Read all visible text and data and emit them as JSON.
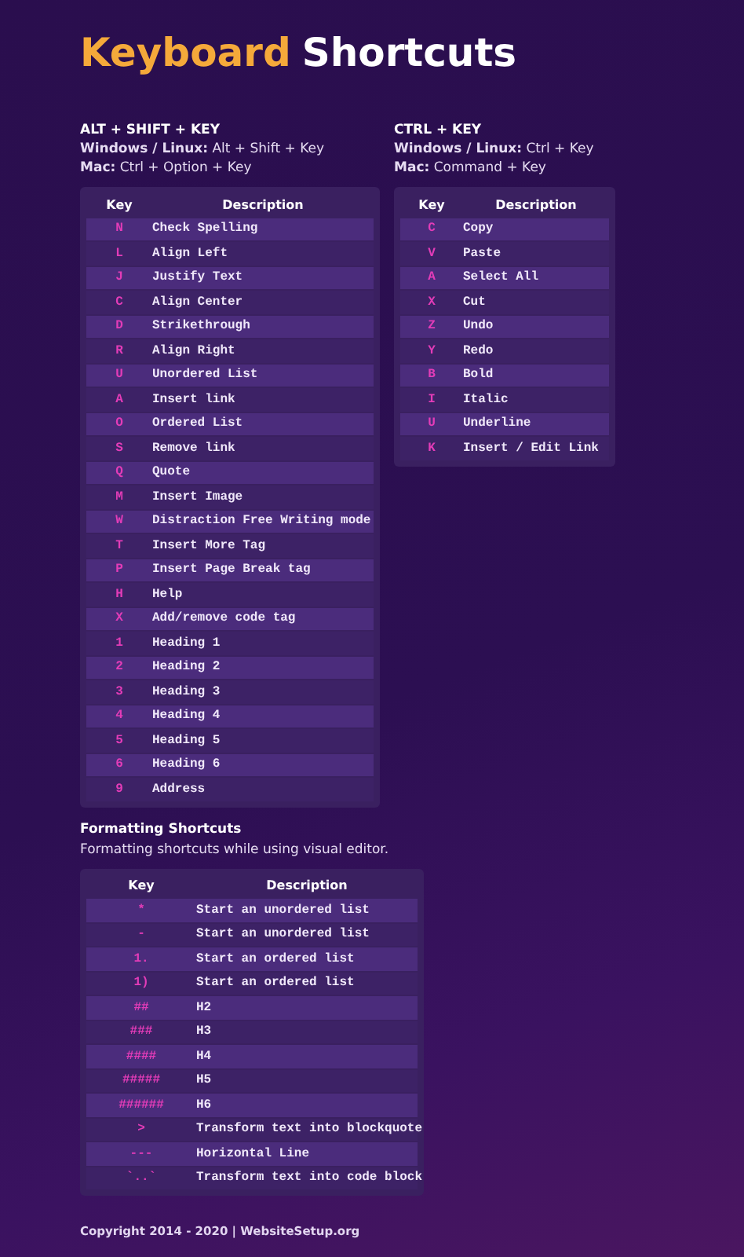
{
  "title": {
    "highlight": "Keyboard",
    "rest": "Shortcuts"
  },
  "sections": [
    {
      "heading": "ALT + SHIFT + KEY",
      "lines": [
        "**Windows / Linux:** Alt + Shift + Key",
        "**Mac:** Ctrl + Option + Key"
      ],
      "columns": [
        "Key",
        "Description"
      ],
      "rows": [
        {
          "key": "N",
          "description": "Check Spelling"
        },
        {
          "key": "L",
          "description": "Align Left"
        },
        {
          "key": "J",
          "description": "Justify Text"
        },
        {
          "key": "C",
          "description": "Align Center"
        },
        {
          "key": "D",
          "description": "Strikethrough"
        },
        {
          "key": "R",
          "description": "Align Right"
        },
        {
          "key": "U",
          "description": "Unordered List"
        },
        {
          "key": "A",
          "description": "Insert link"
        },
        {
          "key": "O",
          "description": "Ordered List"
        },
        {
          "key": "S",
          "description": "Remove link"
        },
        {
          "key": "Q",
          "description": "Quote"
        },
        {
          "key": "M",
          "description": "Insert Image"
        },
        {
          "key": "W",
          "description": "Distraction Free Writing mode"
        },
        {
          "key": "T",
          "description": "Insert More Tag"
        },
        {
          "key": "P",
          "description": "Insert Page Break tag"
        },
        {
          "key": "H",
          "description": "Help"
        },
        {
          "key": "X",
          "description": "Add/remove code tag"
        },
        {
          "key": "1",
          "description": "Heading 1"
        },
        {
          "key": "2",
          "description": "Heading 2"
        },
        {
          "key": "3",
          "description": "Heading 3"
        },
        {
          "key": "4",
          "description": "Heading 4"
        },
        {
          "key": "5",
          "description": "Heading 5"
        },
        {
          "key": "6",
          "description": "Heading 6"
        },
        {
          "key": "9",
          "description": "Address"
        }
      ]
    },
    {
      "heading": "CTRL + KEY",
      "lines": [
        "**Windows / Linux:** Ctrl + Key",
        "**Mac:** Command + Key"
      ],
      "columns": [
        "Key",
        "Description"
      ],
      "rows": [
        {
          "key": "C",
          "description": "Copy"
        },
        {
          "key": "V",
          "description": "Paste"
        },
        {
          "key": "A",
          "description": "Select All"
        },
        {
          "key": "X",
          "description": "Cut"
        },
        {
          "key": "Z",
          "description": "Undo"
        },
        {
          "key": "Y",
          "description": "Redo"
        },
        {
          "key": "B",
          "description": "Bold"
        },
        {
          "key": "I",
          "description": "Italic"
        },
        {
          "key": "U",
          "description": "Underline"
        },
        {
          "key": "K",
          "description": "Insert / Edit Link"
        }
      ]
    }
  ],
  "formatting": {
    "heading": "Formatting Shortcuts",
    "subtitle": "Formatting shortcuts while using visual editor.",
    "columns": [
      "Key",
      "Description"
    ],
    "rows": [
      {
        "key": "*",
        "description": "Start an unordered list"
      },
      {
        "key": "-",
        "description": "Start an unordered list"
      },
      {
        "key": "1.",
        "description": "Start an ordered list"
      },
      {
        "key": "1)",
        "description": "Start an ordered list"
      },
      {
        "key": "##",
        "description": "H2"
      },
      {
        "key": "###",
        "description": "H3"
      },
      {
        "key": "####",
        "description": "H4"
      },
      {
        "key": "#####",
        "description": "H5"
      },
      {
        "key": "######",
        "description": "H6"
      },
      {
        "key": ">",
        "description": "Transform text into blockquote"
      },
      {
        "key": "---",
        "description": "Horizontal Line"
      },
      {
        "key": "`..`",
        "description": "Transform text into code block"
      }
    ]
  },
  "footer": "Copyright 2014 - 2020 | WebsiteSetup.org"
}
